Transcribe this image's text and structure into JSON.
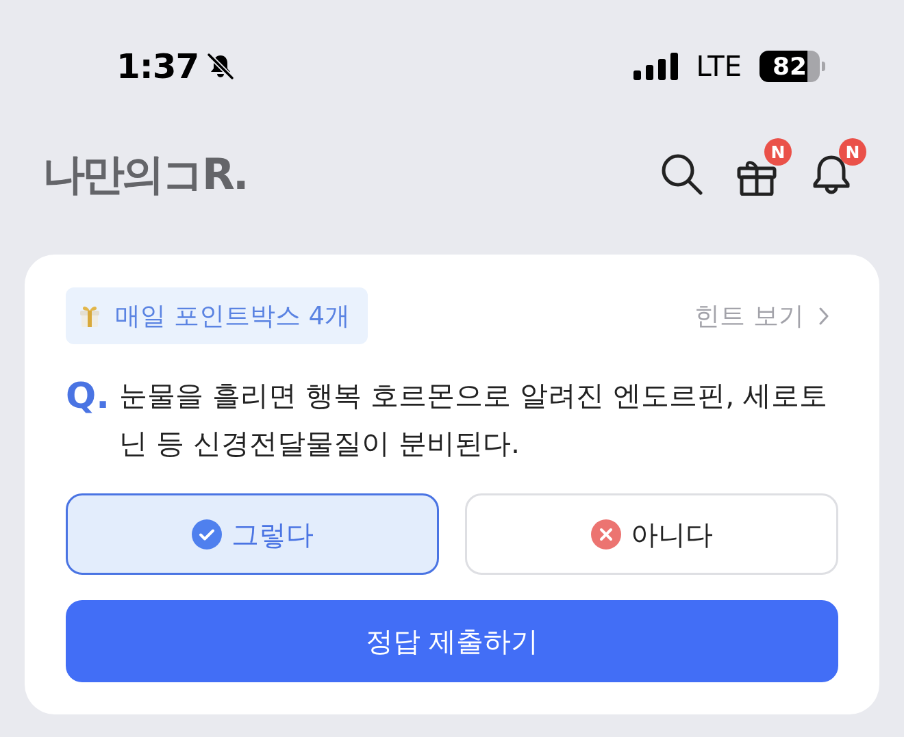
{
  "status_bar": {
    "time": "1:37",
    "silent": true,
    "network": "LTE",
    "battery": "82"
  },
  "header": {
    "logo": "나만의コR.",
    "actions": [
      {
        "kind": "search"
      },
      {
        "kind": "gift",
        "badge": "N"
      },
      {
        "kind": "bell",
        "badge": "N"
      }
    ]
  },
  "quiz": {
    "reward_tag": "매일 포인트박스 4개",
    "hint_link": "힌트 보기",
    "question_mark": "Q.",
    "question": "눈물을 흘리면 행복 호르몬으로 알려진 엔도르핀, 세로토닌 등 신경전달물질이 분비된다.",
    "options": [
      {
        "label": "그렇다",
        "kind": "yes",
        "selected": true
      },
      {
        "label": "아니다",
        "kind": "no",
        "selected": false
      }
    ],
    "submit": "정답 제출하기"
  }
}
